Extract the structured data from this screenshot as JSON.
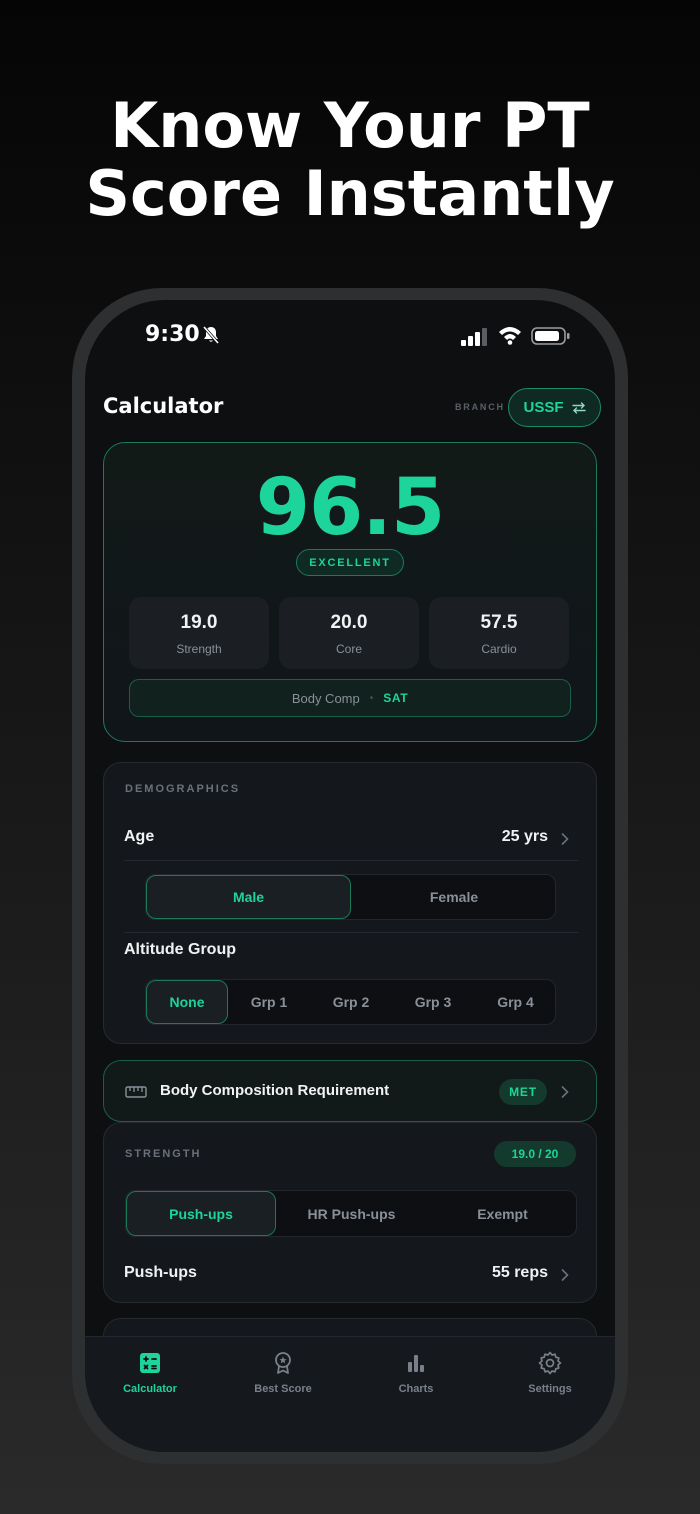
{
  "headline": {
    "line1": "Know Your PT",
    "line2": "Score Instantly"
  },
  "status_bar": {
    "time": "9:30"
  },
  "header": {
    "title": "Calculator",
    "branch_label": "BRANCH",
    "branch_value": "USSF"
  },
  "score": {
    "value": "96.5",
    "rating": "EXCELLENT",
    "components": [
      {
        "value": "19.0",
        "label": "Strength"
      },
      {
        "value": "20.0",
        "label": "Core"
      },
      {
        "value": "57.5",
        "label": "Cardio"
      }
    ],
    "body_comp_label": "Body Comp",
    "body_comp_separator": "•",
    "body_comp_status": "SAT"
  },
  "demographics": {
    "section_label": "DEMOGRAPHICS",
    "age_label": "Age",
    "age_value": "25 yrs",
    "gender_options": [
      "Male",
      "Female"
    ],
    "gender_selected": "Male",
    "altitude_label": "Altitude Group",
    "altitude_options": [
      "None",
      "Grp 1",
      "Grp 2",
      "Grp 3",
      "Grp 4"
    ],
    "altitude_selected": "None"
  },
  "body_comp_requirement": {
    "label": "Body Composition Requirement",
    "status": "MET"
  },
  "strength": {
    "section_label": "STRENGTH",
    "score_badge": "19.0 / 20",
    "options": [
      "Push-ups",
      "HR Push-ups",
      "Exempt"
    ],
    "selected": "Push-ups",
    "exercise_label": "Push-ups",
    "exercise_value": "55 reps"
  },
  "tab_bar": {
    "tabs": [
      {
        "label": "Calculator",
        "icon": "calculator-icon",
        "active": true
      },
      {
        "label": "Best Score",
        "icon": "award-icon",
        "active": false
      },
      {
        "label": "Charts",
        "icon": "bar-chart-icon",
        "active": false
      },
      {
        "label": "Settings",
        "icon": "gear-icon",
        "active": false
      }
    ]
  },
  "colors": {
    "accent": "#1dd49a",
    "background": "#0e0f11",
    "card": "#14171b"
  }
}
